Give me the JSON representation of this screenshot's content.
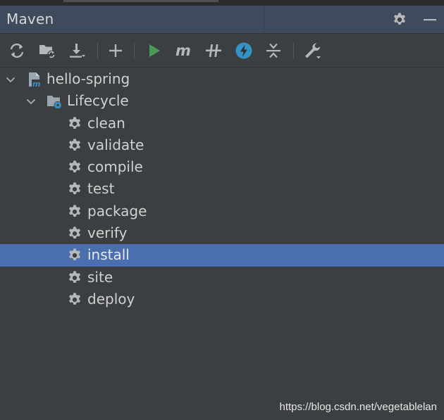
{
  "panel": {
    "title": "Maven",
    "settings_icon": "gear-icon",
    "minimize_icon": "minus-icon"
  },
  "toolbar": {
    "buttons": [
      {
        "name": "reload-all-maven-projects-button",
        "icon": "refresh-icon"
      },
      {
        "name": "generate-sources-button",
        "icon": "folder-refresh-icon"
      },
      {
        "name": "download-sources-button",
        "icon": "download-icon"
      },
      {
        "name": "add-maven-project-button",
        "icon": "plus-icon"
      },
      {
        "name": "run-maven-build-button",
        "icon": "play-icon"
      },
      {
        "name": "execute-maven-goal-button",
        "icon": "maven-m-icon"
      },
      {
        "name": "toggle-offline-mode-button",
        "icon": "offline-icon"
      },
      {
        "name": "skip-tests-button",
        "icon": "lightning-icon"
      },
      {
        "name": "collapse-all-button",
        "icon": "collapse-icon"
      },
      {
        "name": "maven-settings-button",
        "icon": "wrench-icon"
      }
    ]
  },
  "tree": {
    "project": {
      "label": "hello-spring",
      "expanded": true,
      "icon": "maven-project-icon"
    },
    "lifecycle": {
      "label": "Lifecycle",
      "expanded": true,
      "icon": "lifecycle-folder-icon"
    },
    "goals": [
      {
        "label": "clean",
        "selected": false
      },
      {
        "label": "validate",
        "selected": false
      },
      {
        "label": "compile",
        "selected": false
      },
      {
        "label": "test",
        "selected": false
      },
      {
        "label": "package",
        "selected": false
      },
      {
        "label": "verify",
        "selected": false
      },
      {
        "label": "install",
        "selected": true
      },
      {
        "label": "site",
        "selected": false
      },
      {
        "label": "deploy",
        "selected": false
      }
    ]
  },
  "watermark": {
    "text": "https://blog.csdn.net/vegetablelan"
  },
  "colors": {
    "header_bg": "#3d4b5c",
    "panel_bg": "#3c3f41",
    "selection": "#4b6eaf",
    "run_green": "#499c54",
    "accent_blue": "#3592c4"
  }
}
